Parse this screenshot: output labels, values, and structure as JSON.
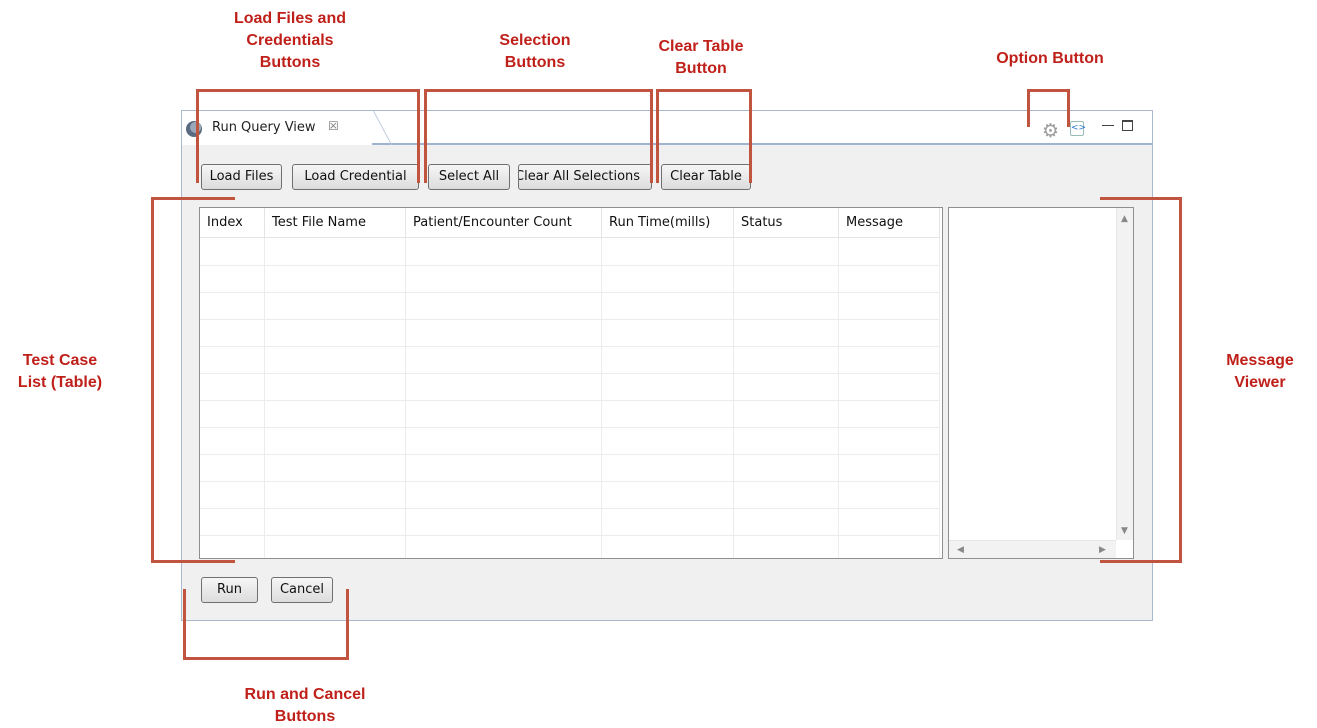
{
  "annotations": {
    "load_buttons": "Load Files and\nCredentials\nButtons",
    "selection_buttons": "Selection\nButtons",
    "clear_table_button": "Clear Table\nButton",
    "option_button": "Option Button",
    "test_case_list": "Test Case\nList (Table)",
    "message_viewer": "Message\nViewer",
    "run_cancel_buttons": "Run and Cancel\nButtons"
  },
  "view": {
    "tab_title": "Run Query View",
    "tab_close": "☒",
    "gear_icon": "⚙",
    "option_icon": "<>"
  },
  "toolbar": {
    "load_files": "Load Files",
    "load_credential": "Load Credential",
    "select_all": "Select All",
    "clear_all_selections": "Clear All Selections",
    "clear_table": "Clear Table"
  },
  "table": {
    "columns": [
      "Index",
      "Test File Name",
      "Patient/Encounter Count",
      "Run Time(mills)",
      "Status",
      "Message"
    ]
  },
  "footer": {
    "run": "Run",
    "cancel": "Cancel"
  },
  "colors": {
    "annotation": "#c0201a",
    "bracket": "#c0543f"
  }
}
